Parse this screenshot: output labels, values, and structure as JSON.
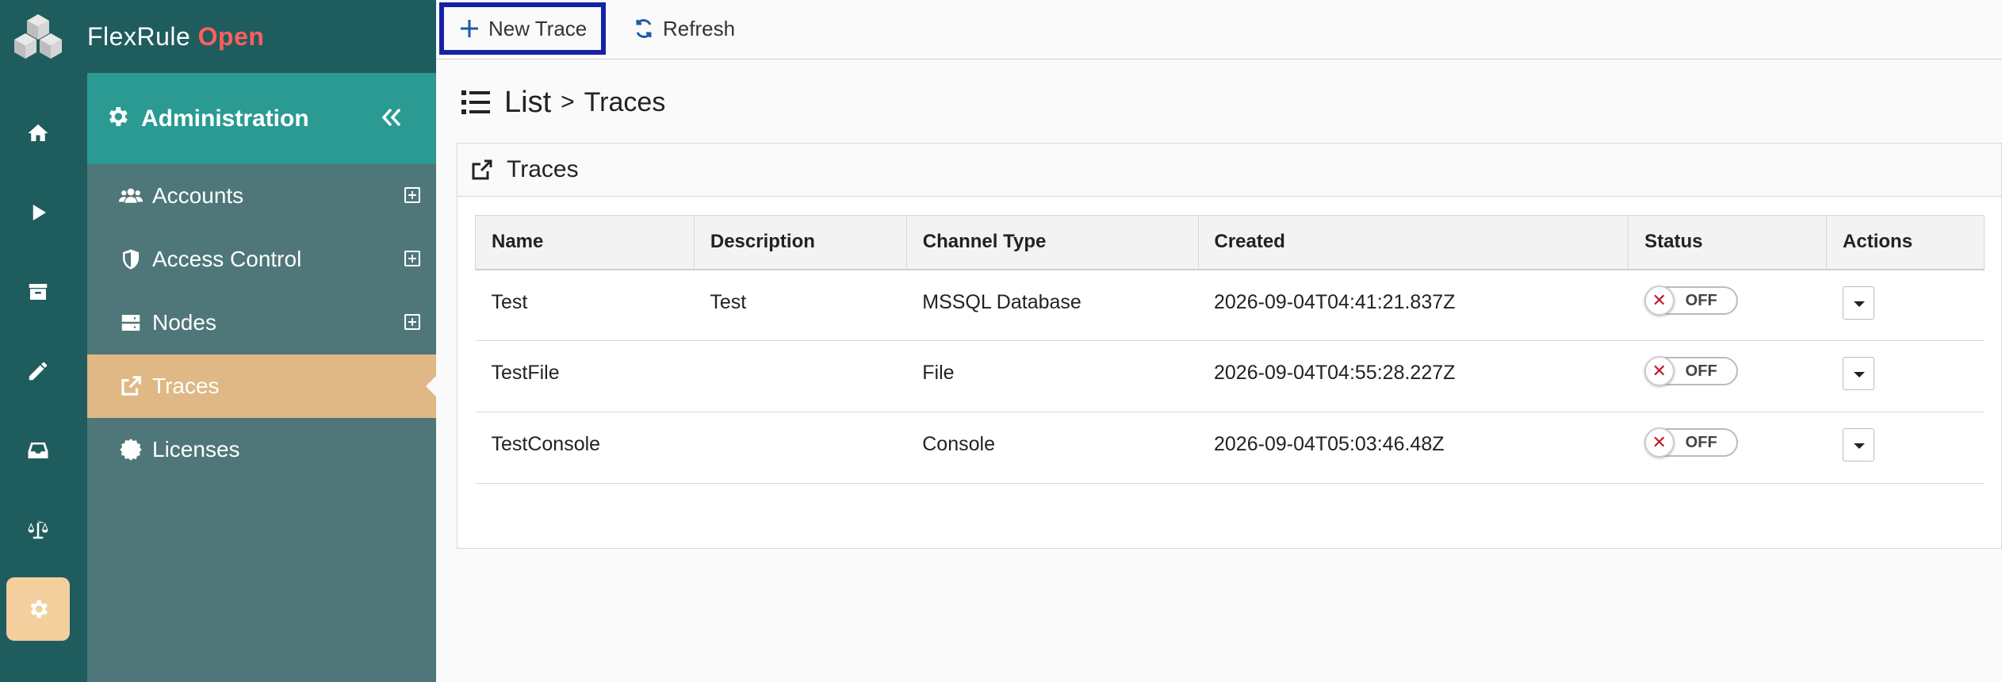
{
  "brand": {
    "name": "FlexRule",
    "edition": "Open"
  },
  "rail": {
    "items": [
      {
        "name": "home",
        "icon": "home-icon"
      },
      {
        "name": "run",
        "icon": "play-icon"
      },
      {
        "name": "archive",
        "icon": "archive-icon"
      },
      {
        "name": "edit",
        "icon": "pencil-icon"
      },
      {
        "name": "inbox",
        "icon": "inbox-icon"
      },
      {
        "name": "scales",
        "icon": "balance-scale-icon"
      },
      {
        "name": "settings",
        "icon": "gear-icon",
        "active": true
      }
    ]
  },
  "sidebar": {
    "header": "Administration",
    "items": [
      {
        "label": "Accounts",
        "icon": "users-icon",
        "expandable": true
      },
      {
        "label": "Access Control",
        "icon": "shield-icon",
        "expandable": true
      },
      {
        "label": "Nodes",
        "icon": "server-icon",
        "expandable": true
      },
      {
        "label": "Traces",
        "icon": "external-link-icon",
        "active": true
      },
      {
        "label": "Licenses",
        "icon": "certificate-icon"
      }
    ]
  },
  "toolbar": {
    "new_label": "New Trace",
    "refresh_label": "Refresh"
  },
  "breadcrumb": {
    "root": "List",
    "separator": ">",
    "current": "Traces"
  },
  "panel": {
    "title": "Traces",
    "columns": [
      "Name",
      "Description",
      "Channel Type",
      "Created",
      "Status",
      "Actions"
    ],
    "rows": [
      {
        "name": "Test",
        "description": "Test",
        "channel": "MSSQL Database",
        "created": "2026-09-04T04:41:21.837Z",
        "status": "OFF"
      },
      {
        "name": "TestFile",
        "description": "",
        "channel": "File",
        "created": "2026-09-04T04:55:28.227Z",
        "status": "OFF"
      },
      {
        "name": "TestConsole",
        "description": "",
        "channel": "Console",
        "created": "2026-09-04T05:03:46.48Z",
        "status": "OFF"
      }
    ]
  },
  "colors": {
    "rail": "#1f5c5e",
    "nav": "#4f7779",
    "nav_header": "#2a9a92",
    "active": "#dfb886",
    "brand_open": "#ff5f5f",
    "highlight_border": "#1521a6"
  }
}
